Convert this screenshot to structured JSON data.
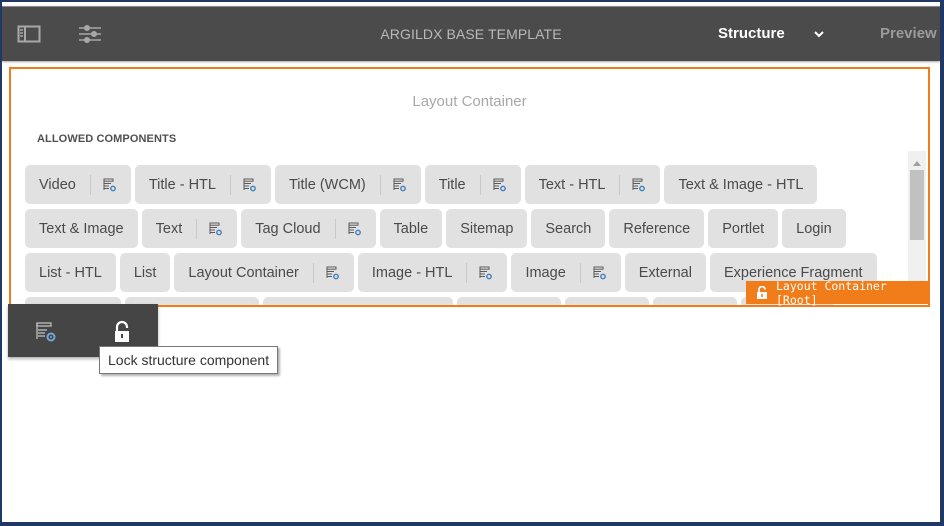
{
  "header": {
    "title": "ARGILDX BASE TEMPLATE",
    "mode": "Structure",
    "preview": "Preview",
    "icons": [
      "side-panel-icon",
      "page-properties-icon",
      "chevron-down-icon"
    ]
  },
  "container": {
    "title": "Layout Container",
    "allowed_label": "ALLOWED COMPONENTS",
    "chips": [
      {
        "label": "Video",
        "policy": true
      },
      {
        "label": "Title - HTL",
        "policy": true
      },
      {
        "label": "Title (WCM)",
        "policy": true
      },
      {
        "label": "Title",
        "policy": true
      },
      {
        "label": "Text - HTL",
        "policy": true
      },
      {
        "label": "Text & Image - HTL",
        "policy": false
      },
      {
        "label": "Text & Image",
        "policy": false
      },
      {
        "label": "Text",
        "policy": true
      },
      {
        "label": "Tag Cloud",
        "policy": true
      },
      {
        "label": "Table",
        "policy": false
      },
      {
        "label": "Sitemap",
        "policy": false
      },
      {
        "label": "Search",
        "policy": false
      },
      {
        "label": "Reference",
        "policy": false
      },
      {
        "label": "Portlet",
        "policy": false
      },
      {
        "label": "Login",
        "policy": false
      },
      {
        "label": "List - HTL",
        "policy": false
      },
      {
        "label": "List",
        "policy": false
      },
      {
        "label": "Layout Container",
        "policy": true
      },
      {
        "label": "Image - HTL",
        "policy": true
      },
      {
        "label": "Image",
        "policy": true
      },
      {
        "label": "External",
        "policy": false
      },
      {
        "label": "Experience Fragment",
        "policy": false
      }
    ],
    "root_badge": "Layout Container [Root]"
  },
  "toolbar": {
    "buttons": [
      {
        "name": "policy-button",
        "icon": "policy-icon"
      },
      {
        "name": "lock-structure-button",
        "icon": "unlock-icon"
      }
    ],
    "tooltip": "Lock structure component"
  },
  "colors": {
    "accent": "#f07c1a",
    "header_bg": "#4b4b4b",
    "chip_bg": "#e1e1e1",
    "frame": "#1f3864"
  }
}
